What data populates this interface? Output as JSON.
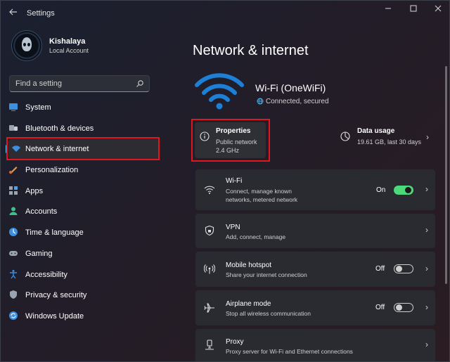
{
  "window": {
    "title": "Settings"
  },
  "user": {
    "name": "Kishalaya",
    "account_type": "Local Account"
  },
  "search": {
    "placeholder": "Find a setting"
  },
  "sidebar": {
    "items": [
      {
        "label": "System",
        "icon": "system-icon"
      },
      {
        "label": "Bluetooth & devices",
        "icon": "bluetooth-icon"
      },
      {
        "label": "Network & internet",
        "icon": "network-icon",
        "active": true
      },
      {
        "label": "Personalization",
        "icon": "personalization-icon"
      },
      {
        "label": "Apps",
        "icon": "apps-icon"
      },
      {
        "label": "Accounts",
        "icon": "accounts-icon"
      },
      {
        "label": "Time & language",
        "icon": "time-language-icon"
      },
      {
        "label": "Gaming",
        "icon": "gaming-icon"
      },
      {
        "label": "Accessibility",
        "icon": "accessibility-icon"
      },
      {
        "label": "Privacy & security",
        "icon": "privacy-icon"
      },
      {
        "label": "Windows Update",
        "icon": "windows-update-icon"
      }
    ]
  },
  "main": {
    "title": "Network & internet",
    "network": {
      "name": "Wi-Fi (OneWiFi)",
      "status": "Connected, secured"
    },
    "properties": {
      "title": "Properties",
      "line1": "Public network",
      "line2": "2.4 GHz"
    },
    "data_usage": {
      "title": "Data usage",
      "detail": "19.61 GB, last 30 days"
    },
    "rows": [
      {
        "title": "Wi-Fi",
        "subtitle_line1": "Connect, manage known",
        "subtitle_line2": "networks, metered network",
        "toggle_label": "On",
        "toggle": "on",
        "icon": "wifi-icon"
      },
      {
        "title": "VPN",
        "subtitle_line1": "Add, connect, manage",
        "icon": "vpn-shield-icon"
      },
      {
        "title": "Mobile hotspot",
        "subtitle_line1": "Share your internet connection",
        "toggle_label": "Off",
        "toggle": "off",
        "icon": "hotspot-icon"
      },
      {
        "title": "Airplane mode",
        "subtitle_line1": "Stop all wireless communication",
        "toggle_label": "Off",
        "toggle": "off",
        "icon": "airplane-icon"
      },
      {
        "title": "Proxy",
        "subtitle_line1": "Proxy server for Wi-Fi and Ethernet connections",
        "icon": "proxy-icon"
      }
    ]
  },
  "colors": {
    "accent": "#4cc2ff",
    "toggle_on": "#4cd97a",
    "highlight": "#e3161f",
    "wifi_icon": "#1e7fd6"
  }
}
